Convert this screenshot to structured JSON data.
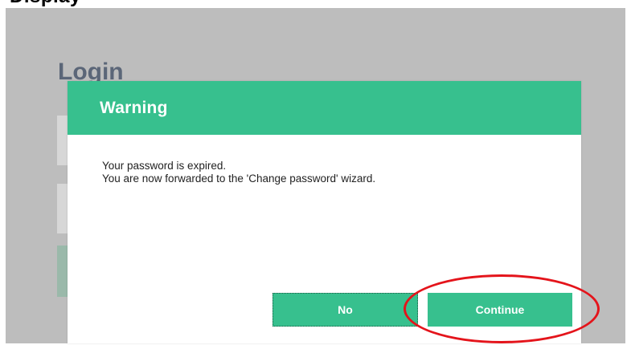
{
  "page_heading_fragment": "Display",
  "background": {
    "login_heading": "Login"
  },
  "dialog": {
    "title": "Warning",
    "message_line1": "Your password is expired.",
    "message_line2": "You are now forwarded to the 'Change password' wizard.",
    "no_label": "No",
    "continue_label": "Continue"
  },
  "colors": {
    "accent": "#37c08e",
    "backdrop": "#bdbdbd",
    "highlight": "#e4141b",
    "heading": "#5b6678"
  }
}
